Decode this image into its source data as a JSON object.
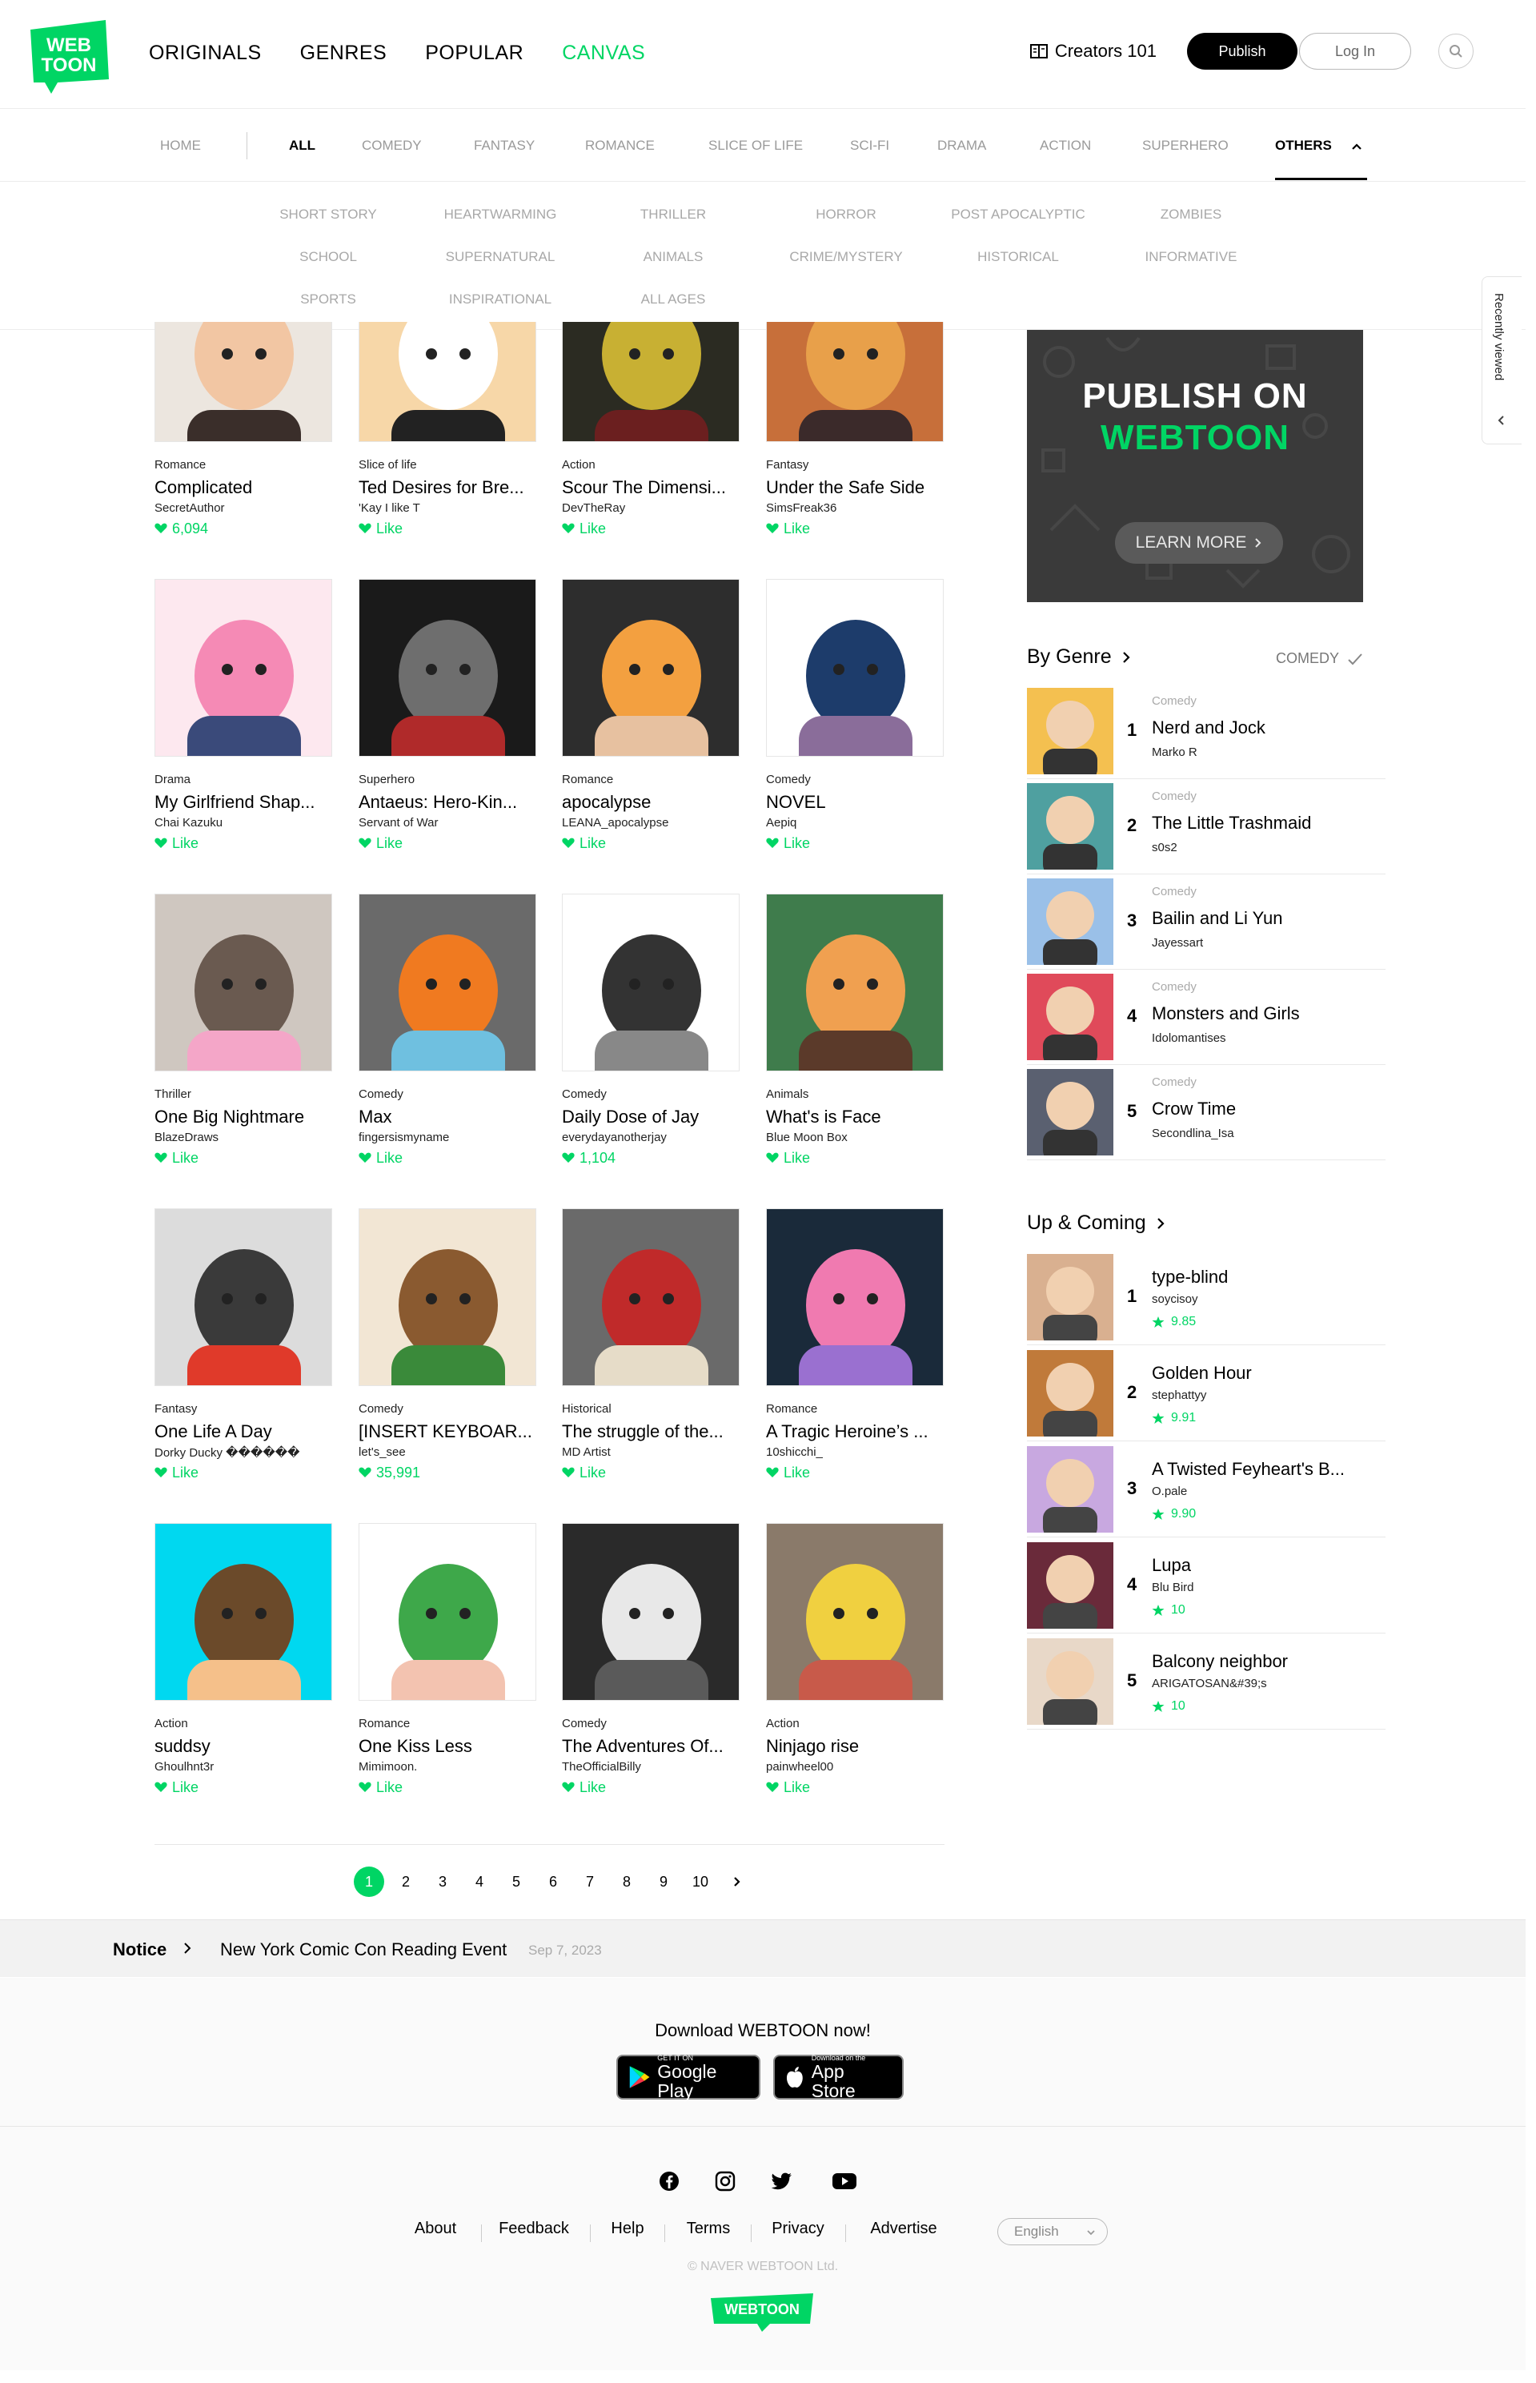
{
  "brand": {
    "logo_text_1": "WEB",
    "logo_text_2": "TOON",
    "color": "#00d564"
  },
  "nav": {
    "originals": "ORIGINALS",
    "genres": "GENRES",
    "popular": "POPULAR",
    "canvas": "CANVAS"
  },
  "header": {
    "creators": "Creators 101",
    "publish": "Publish",
    "login": "Log In",
    "search_icon": "search-icon"
  },
  "tabs": [
    "HOME",
    "ALL",
    "COMEDY",
    "FANTASY",
    "ROMANCE",
    "SLICE OF LIFE",
    "SCI-FI",
    "DRAMA",
    "ACTION",
    "SUPERHERO",
    "OTHERS"
  ],
  "active_tab": "ALL",
  "sub_genres": [
    [
      "SHORT STORY",
      "HEARTWARMING",
      "THRILLER",
      "HORROR",
      "POST APOCALYPTIC",
      "ZOMBIES"
    ],
    [
      "SCHOOL",
      "SUPERNATURAL",
      "ANIMALS",
      "CRIME/MYSTERY",
      "HISTORICAL",
      "INFORMATIVE"
    ],
    [
      "SPORTS",
      "INSPIRATIONAL",
      "ALL AGES"
    ]
  ],
  "recently_viewed": "Recently viewed",
  "cards": [
    {
      "genre": "Romance",
      "title": "Complicated",
      "author": "SecretAuthor",
      "likes": "6,094"
    },
    {
      "genre": "Slice of life",
      "title": "Ted Desires for Bre...",
      "author": "'Kay I like T",
      "likes": "Like"
    },
    {
      "genre": "Action",
      "title": "Scour The Dimensi...",
      "author": "DevTheRay",
      "likes": "Like"
    },
    {
      "genre": "Fantasy",
      "title": "Under the Safe Side",
      "author": "SimsFreak36",
      "likes": "Like"
    },
    {
      "genre": "Drama",
      "title": "My Girlfriend Shap...",
      "author": "Chai Kazuku",
      "likes": "Like"
    },
    {
      "genre": "Superhero",
      "title": "Antaeus: Hero-Kin...",
      "author": "Servant of War",
      "likes": "Like"
    },
    {
      "genre": "Romance",
      "title": "apocalypse",
      "author": "LEANA_apocalypse",
      "likes": "Like"
    },
    {
      "genre": "Comedy",
      "title": "NOVEL",
      "author": "Aepiq",
      "likes": "Like"
    },
    {
      "genre": "Thriller",
      "title": "One Big Nightmare",
      "author": "BlazeDraws",
      "likes": "Like"
    },
    {
      "genre": "Comedy",
      "title": "Max",
      "author": "fingersismyname",
      "likes": "Like"
    },
    {
      "genre": "Comedy",
      "title": "Daily Dose of Jay",
      "author": "everydayanotherjay",
      "likes": "1,104"
    },
    {
      "genre": "Animals",
      "title": "What's is Face",
      "author": "Blue Moon Box",
      "likes": "Like"
    },
    {
      "genre": "Fantasy",
      "title": "One Life A Day",
      "author": "Dorky Ducky ������",
      "likes": "Like"
    },
    {
      "genre": "Comedy",
      "title": "[INSERT KEYBOAR...",
      "author": "let's_see",
      "likes": "35,991"
    },
    {
      "genre": "Historical",
      "title": "The struggle of the...",
      "author": "MD Artist",
      "likes": "Like"
    },
    {
      "genre": "Romance",
      "title": "A Tragic Heroine’s ...",
      "author": "10shicchi_",
      "likes": "Like"
    },
    {
      "genre": "Action",
      "title": "suddsy",
      "author": "Ghoulhnt3r",
      "likes": "Like"
    },
    {
      "genre": "Romance",
      "title": "One Kiss Less",
      "author": "Mimimoon.",
      "likes": "Like"
    },
    {
      "genre": "Comedy",
      "title": "The Adventures Of...",
      "author": "TheOfficialBilly",
      "likes": "Like"
    },
    {
      "genre": "Action",
      "title": "Ninjago rise",
      "author": "painwheel00",
      "likes": "Like"
    }
  ],
  "pagination": {
    "pages": [
      "1",
      "2",
      "3",
      "4",
      "5",
      "6",
      "7",
      "8",
      "9",
      "10"
    ],
    "current": "1"
  },
  "promo": {
    "line1": "PUBLISH ON",
    "line2": "WEBTOON",
    "button": "LEARN MORE"
  },
  "by_genre": {
    "heading": "By Genre",
    "filter": "COMEDY",
    "items": [
      {
        "rank": "1",
        "genre": "Comedy",
        "title": "Nerd and Jock",
        "author": "Marko R"
      },
      {
        "rank": "2",
        "genre": "Comedy",
        "title": "The Little Trashmaid",
        "author": "s0s2"
      },
      {
        "rank": "3",
        "genre": "Comedy",
        "title": "Bailin and Li Yun",
        "author": "Jayessart"
      },
      {
        "rank": "4",
        "genre": "Comedy",
        "title": "Monsters and Girls",
        "author": "Idolomantises"
      },
      {
        "rank": "5",
        "genre": "Comedy",
        "title": "Crow Time",
        "author": "Secondlina_Isa"
      }
    ]
  },
  "up_coming": {
    "heading": "Up & Coming",
    "items": [
      {
        "rank": "1",
        "title": "type-blind",
        "author": "soycisoy",
        "score": "9.85"
      },
      {
        "rank": "2",
        "title": "Golden Hour",
        "author": "stephattyy",
        "score": "9.91"
      },
      {
        "rank": "3",
        "title": "A Twisted Feyheart's B...",
        "author": "O.pale",
        "score": "9.90"
      },
      {
        "rank": "4",
        "title": "Lupa",
        "author": "Blu Bird",
        "score": "10"
      },
      {
        "rank": "5",
        "title": "Balcony neighbor",
        "author": "ARIGATOSAN&#39;s",
        "score": "10"
      }
    ]
  },
  "notice": {
    "label": "Notice",
    "title": "New York Comic Con Reading Event",
    "date": "Sep 7, 2023"
  },
  "download": {
    "title": "Download WEBTOON now!",
    "google_small": "GET IT ON",
    "google_big": "Google Play",
    "apple_small": "Download on the",
    "apple_big": "App Store"
  },
  "footer": {
    "links": [
      "About",
      "Feedback",
      "Help",
      "Terms",
      "Privacy",
      "Advertise"
    ],
    "language": "English",
    "copyright": "© NAVER WEBTOON Ltd.",
    "logo": "WEBTOON"
  }
}
